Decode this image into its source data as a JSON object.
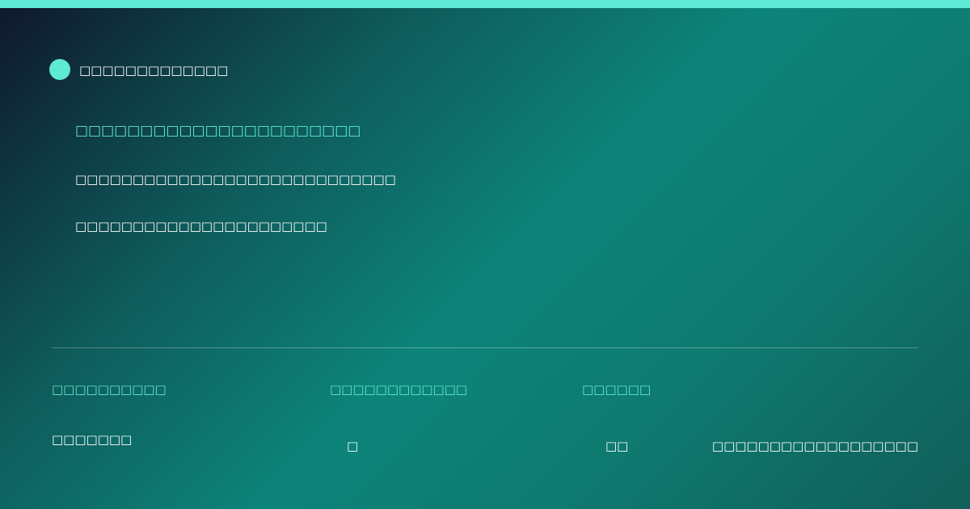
{
  "colors": {
    "accent": "#5eead4",
    "background_start": "#0f172a",
    "background_mid": "#0d847a",
    "background_end": "#115e59",
    "text": "#ffffff"
  },
  "brand": {
    "icon": "teal-circle-icon",
    "name": "□□□□□□□□□□□□□"
  },
  "main": {
    "headline": "□□□□□□□□□□□□□□□□□□□□□□",
    "line_2": "□□□□□□□□□□□□□□□□□□□□□□□□□□□□",
    "line_3": "□□□□□□□□□□□□□□□□□□□□□□"
  },
  "footer": {
    "labels": [
      "□□□□□□□□□□",
      "□□□□□□□□□□□□",
      "□□□□□□"
    ],
    "values": [
      "□□□□□□□",
      "□",
      "□□",
      "□□□□□□□□□□□□□□□□□□"
    ]
  }
}
